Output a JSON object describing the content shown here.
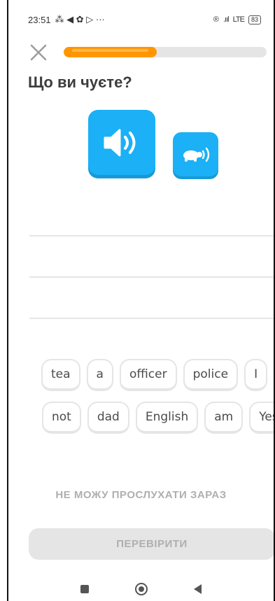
{
  "status_bar": {
    "time": "23:51",
    "left_icons": "⁂ ◀ ✿ ▷ ···",
    "right_icons": "®",
    "signal": ".ııl",
    "lte": "LTE",
    "battery": "83"
  },
  "lesson": {
    "progress": 0.46,
    "prompt": "Що ви чуєте?"
  },
  "word_bank": {
    "row1": [
      "tea",
      "a",
      "officer",
      "police",
      "I"
    ],
    "row2": [
      "not",
      "dad",
      "English",
      "am",
      "Yes"
    ]
  },
  "actions": {
    "cant_listen": "НЕ МОЖУ ПРОСЛУХАТИ ЗАРАЗ",
    "check": "ПЕРЕВІРИТИ"
  },
  "colors": {
    "accent_blue": "#1cb0f6",
    "progress_orange": "#ff9600",
    "disabled_gray": "#e5e5e5"
  },
  "icons": {
    "close": "close-icon",
    "speaker": "speaker-icon",
    "turtle": "turtle-icon"
  }
}
